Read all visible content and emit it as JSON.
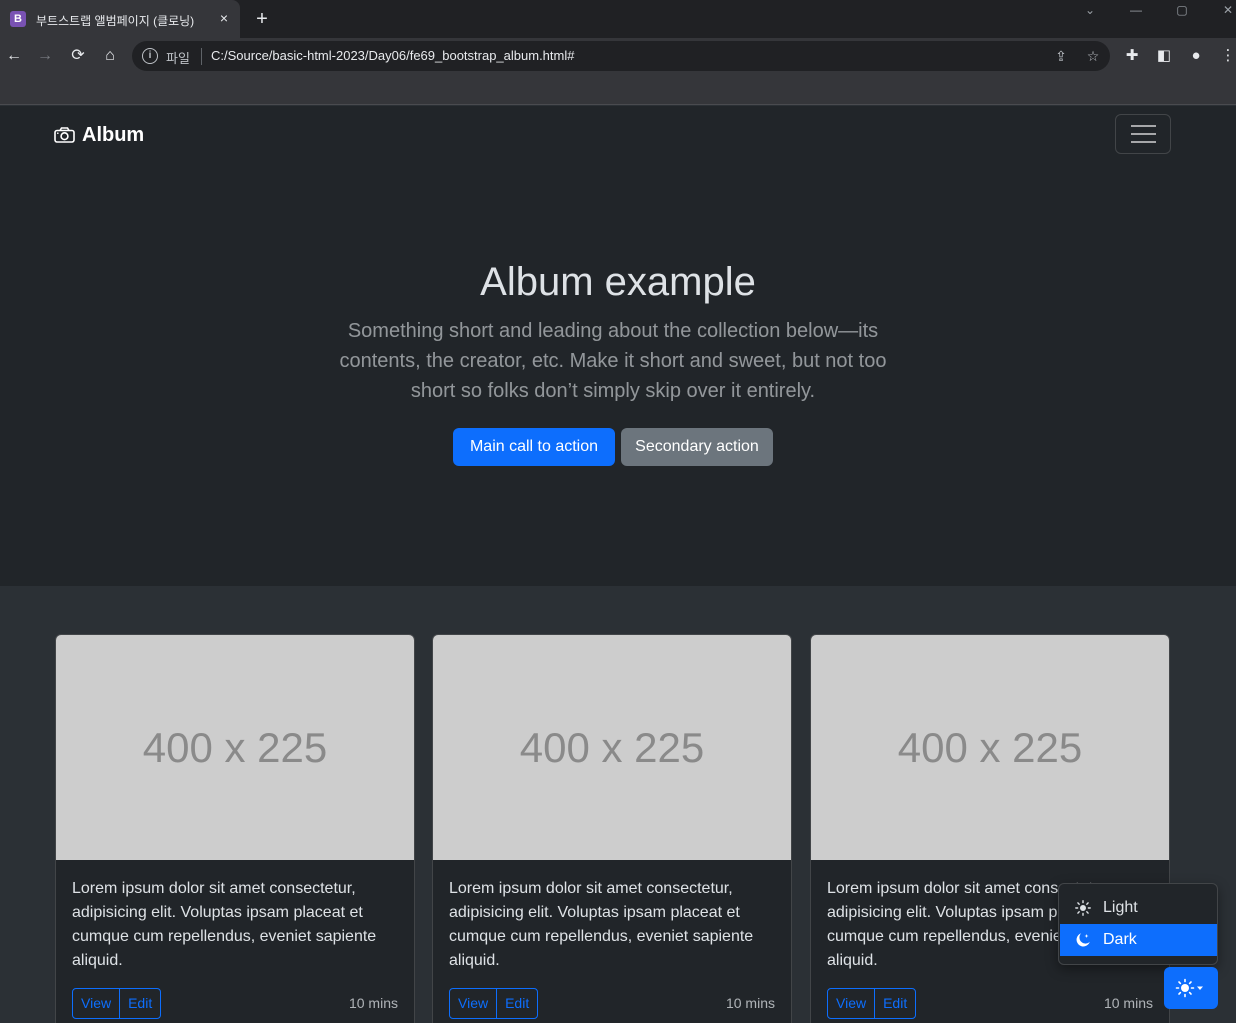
{
  "browser": {
    "tab_title": "부트스트랩 앨범페이지 (클로닝)",
    "tab_favicon": "B",
    "tab_close": "×",
    "new_tab": "+",
    "omnibox_label": "파일",
    "url": "C:/Source/basic-html-2023/Day06/fe69_bootstrap_album.html#"
  },
  "navbar": {
    "brand": "Album"
  },
  "hero": {
    "title": "Album example",
    "lead": "Something short and leading about the collection below—its contents, the creator, etc. Make it short and sweet, but not too short so folks don’t simply skip over it entirely.",
    "primary_button": "Main call to action",
    "secondary_button": "Secondary action"
  },
  "cards": [
    {
      "image_label": "400 x 225",
      "text": "Lorem ipsum dolor sit amet consectetur, adipisicing elit. Voluptas ipsam placeat et cumque cum repellendus, eveniet sapiente aliquid.",
      "view": "View",
      "edit": "Edit",
      "time": "10 mins"
    },
    {
      "image_label": "400 x 225",
      "text": "Lorem ipsum dolor sit amet consectetur, adipisicing elit. Voluptas ipsam placeat et cumque cum repellendus, eveniet sapiente aliquid.",
      "view": "View",
      "edit": "Edit",
      "time": "10 mins"
    },
    {
      "image_label": "400 x 225",
      "text": "Lorem ipsum dolor sit amet consectetur, adipisicing elit. Voluptas ipsam placeat et cumque cum repellendus, eveniet sapiente aliquid.",
      "view": "View",
      "edit": "Edit",
      "time": "10 mins"
    }
  ],
  "theme_menu": {
    "items": [
      {
        "label": "Light",
        "icon": "sun-icon"
      },
      {
        "label": "Dark",
        "icon": "moon-stars-icon",
        "active": true
      }
    ]
  },
  "colors": {
    "primary": "#0d6efd",
    "secondary": "#6c757d",
    "body_bg_dark": "#212529",
    "album_bg": "#2b3035",
    "placeholder_gray": "#cdcdcd"
  }
}
